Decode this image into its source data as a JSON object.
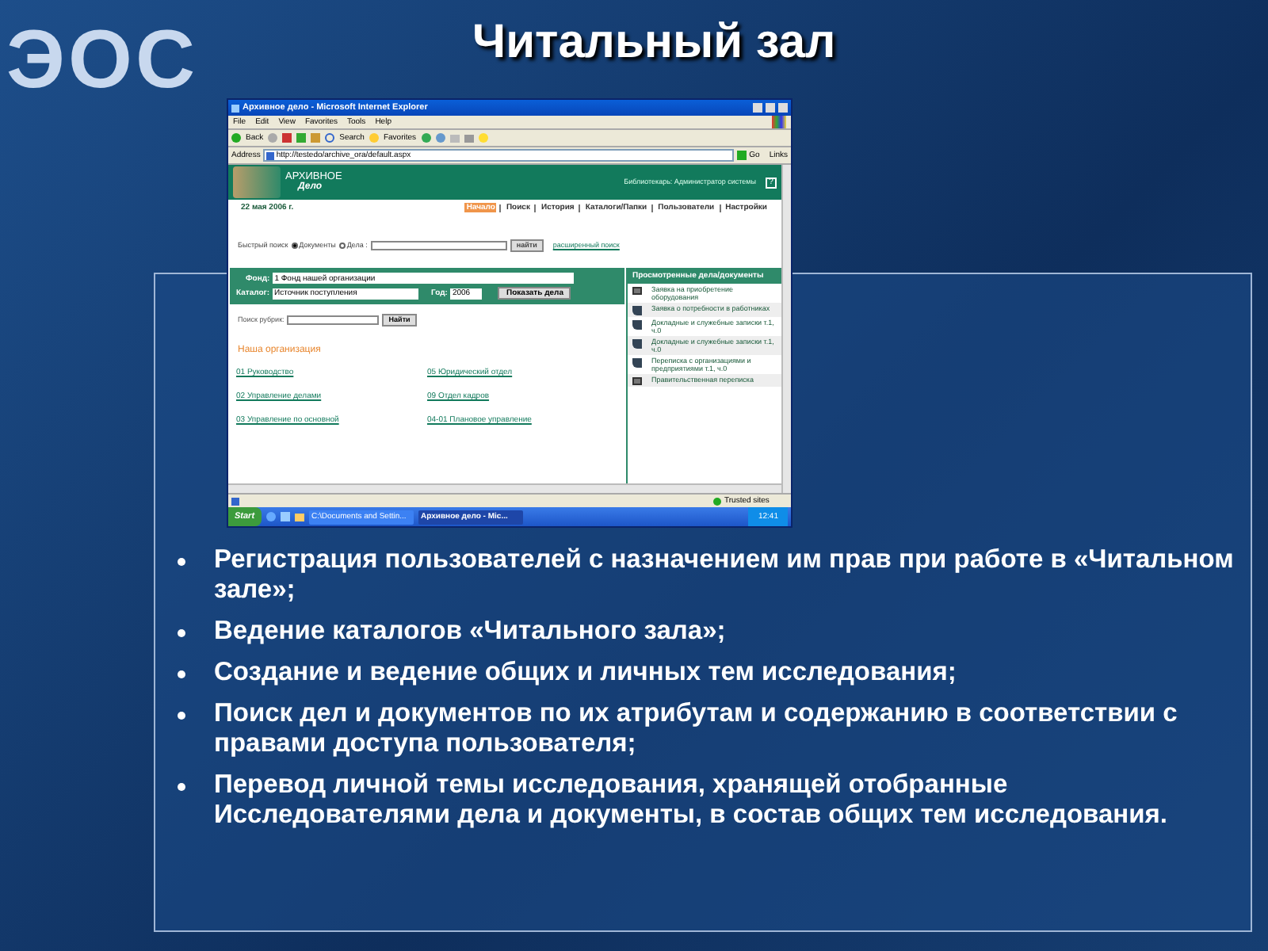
{
  "slide": {
    "logo": "ЭОС",
    "title": "Читальный зал"
  },
  "browser": {
    "title": "Архивное дело - Microsoft Internet Explorer",
    "menu": [
      "File",
      "Edit",
      "View",
      "Favorites",
      "Tools",
      "Help"
    ],
    "toolbar": [
      "Back",
      "Search",
      "Favorites"
    ],
    "address_label": "Address",
    "url": "http://testedo/archive_ora/default.aspx",
    "go": "Go",
    "links": "Links",
    "page": {
      "brand_line1": "АРХИВНОЕ",
      "brand_line2": "Дело",
      "user": "Библиотекарь: Администратор системы",
      "help": "?",
      "date": "22 мая 2006 г.",
      "nav": [
        {
          "label": "Начало",
          "selected": true
        },
        {
          "label": "Поиск",
          "selected": false
        },
        {
          "label": "История",
          "selected": false
        },
        {
          "label": "Каталоги/Папки",
          "selected": false
        },
        {
          "label": "Пользователи",
          "selected": false
        },
        {
          "label": "Настройки",
          "selected": false
        }
      ],
      "quick_search": {
        "label": "Быстрый поиск",
        "options": [
          {
            "label": "Документы",
            "selected": true
          },
          {
            "label": "Дела :",
            "selected": false
          }
        ],
        "button": "найти",
        "advanced": "расширенный поиск"
      },
      "filters": {
        "fond_label": "Фонд:",
        "fond_value": "1 Фонд нашей организации",
        "catalog_label": "Каталог:",
        "catalog_value": "Источник поступления",
        "year_label": "Год:",
        "year_value": "2006",
        "show_button": "Показать дела"
      },
      "rubric": {
        "label": "Поиск рубрик:",
        "button": "Найти"
      },
      "org_title": "Наша организация",
      "org_links": [
        "01 Руководство",
        "05 Юридический отдел",
        "02 Управление делами",
        "09 Отдел кадров",
        "03 Управление по основной",
        "04-01 Плановое управление"
      ],
      "viewed": {
        "title": "Просмотренные дела/документы",
        "items": [
          {
            "kind": "case",
            "label": "Заявка на приобретение оборудования"
          },
          {
            "kind": "document",
            "label": "Заявка о потребности в работниках"
          },
          {
            "kind": "document",
            "label": "Докладные и служебные записки т.1, ч.0"
          },
          {
            "kind": "document",
            "label": "Докладные и служебные записки т.1, ч.0"
          },
          {
            "kind": "document",
            "label": "Переписка с организациями и предприятиями т.1, ч.0"
          },
          {
            "kind": "case",
            "label": "Правительственная переписка"
          }
        ]
      }
    },
    "status": {
      "zone": "Trusted sites"
    },
    "taskbar": {
      "start": "Start",
      "tasks": [
        {
          "label": "C:\\Documents and Settin...",
          "selected": false
        },
        {
          "label": "Архивное дело - Mic...",
          "selected": true
        }
      ],
      "clock": "12:41"
    }
  },
  "bullets": [
    "Регистрация пользователей с назначением им прав при работе в «Читальном зале»;",
    "Ведение каталогов «Читального зала»;",
    "Создание и ведение общих и личных тем исследования;",
    "Поиск дел и документов по их атрибутам и содержанию в соответствии с правами доступа пользователя;",
    "Перевод личной темы исследования, хранящей отобранные Исследователями дела и документы, в состав общих тем исследования."
  ]
}
